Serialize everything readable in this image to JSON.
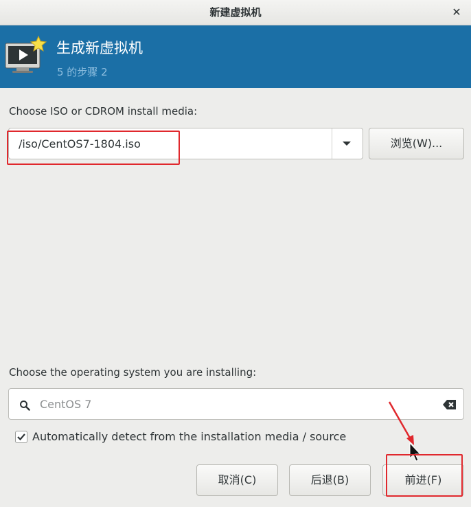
{
  "window": {
    "title": "新建虚拟机"
  },
  "banner": {
    "title": "生成新虚拟机",
    "step": "5 的步骤 2"
  },
  "install_media": {
    "label": "Choose ISO or CDROM install media:",
    "path_value": "/iso/CentOS7-1804.iso",
    "browse_label": "浏览(W)..."
  },
  "os_select": {
    "label": "Choose the operating system you are installing:",
    "search_value": "CentOS 7",
    "auto_detect_label": "Automatically detect from the installation media / source",
    "auto_detect_checked": true
  },
  "buttons": {
    "cancel": "取消(C)",
    "back": "后退(B)",
    "forward": "前进(F)"
  },
  "annotation": {
    "color": "#e0282d"
  },
  "colors": {
    "banner": "#1b6fa6",
    "banner_step_text": "#8fbfe0"
  }
}
